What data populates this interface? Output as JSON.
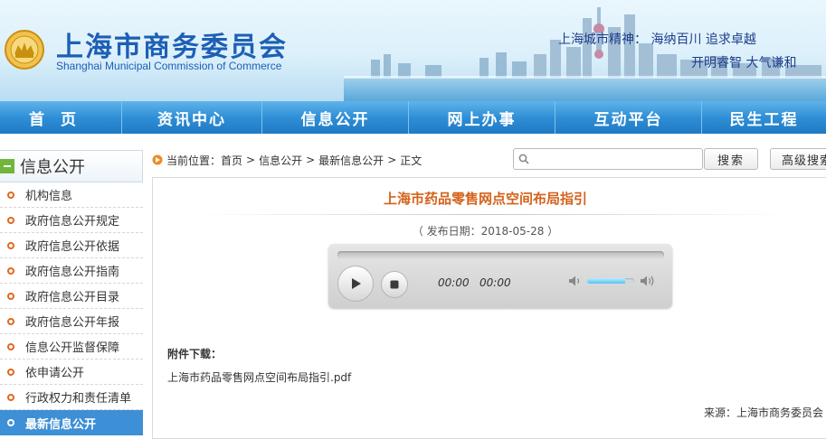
{
  "header": {
    "site_title_cn": "上海市商务委员会",
    "site_title_en": "Shanghai Municipal Commission of Commerce",
    "motto_line1": "上海城市精神：  海纳百川    追求卓越",
    "motto_line2": "开明睿智    大气谦和"
  },
  "nav": {
    "items": [
      {
        "label": "首页"
      },
      {
        "label": "资讯中心"
      },
      {
        "label": "信息公开"
      },
      {
        "label": "网上办事"
      },
      {
        "label": "互动平台"
      },
      {
        "label": "民生工程"
      }
    ]
  },
  "sidebar": {
    "title": "信息公开",
    "items": [
      {
        "label": "机构信息"
      },
      {
        "label": "政府信息公开规定"
      },
      {
        "label": "政府信息公开依据"
      },
      {
        "label": "政府信息公开指南"
      },
      {
        "label": "政府信息公开目录"
      },
      {
        "label": "政府信息公开年报"
      },
      {
        "label": "信息公开监督保障"
      },
      {
        "label": "依申请公开"
      },
      {
        "label": "行政权力和责任清单"
      },
      {
        "label": "最新信息公开"
      }
    ],
    "active_index": 9
  },
  "breadcrumb": {
    "prefix": "当前位置：",
    "items": [
      "首页",
      "信息公开",
      "最新信息公开",
      "正文"
    ],
    "separator": ">"
  },
  "search": {
    "value": "",
    "placeholder": "",
    "button_label": "搜索",
    "advanced_label": "高级搜索"
  },
  "article": {
    "title": "上海市药品零售网点空间布局指引",
    "pubdate": "（ 发布日期：2018-05-28 ）",
    "attachment_label": "附件下载：",
    "attachment_file": "上海市药品零售网点空间布局指引.pdf",
    "source": "来源：上海市商务委员会"
  },
  "player": {
    "current_time": "00:00",
    "duration": "00:00",
    "progress": 0,
    "volume": 0.8
  },
  "colors": {
    "nav_blue": "#2f8fd6",
    "title_orange": "#d5621b",
    "bullet_orange": "#e2681c",
    "active_blue": "#3d8fd6",
    "brand_blue": "#1d5fb5"
  },
  "icons": {
    "logo": "commerce-emblem-icon",
    "breadcrumb": "location-flag-icon",
    "search": "magnifier-icon",
    "play": "play-icon",
    "stop": "stop-icon",
    "volume_low": "volume-low-icon",
    "volume_high": "volume-high-icon"
  }
}
